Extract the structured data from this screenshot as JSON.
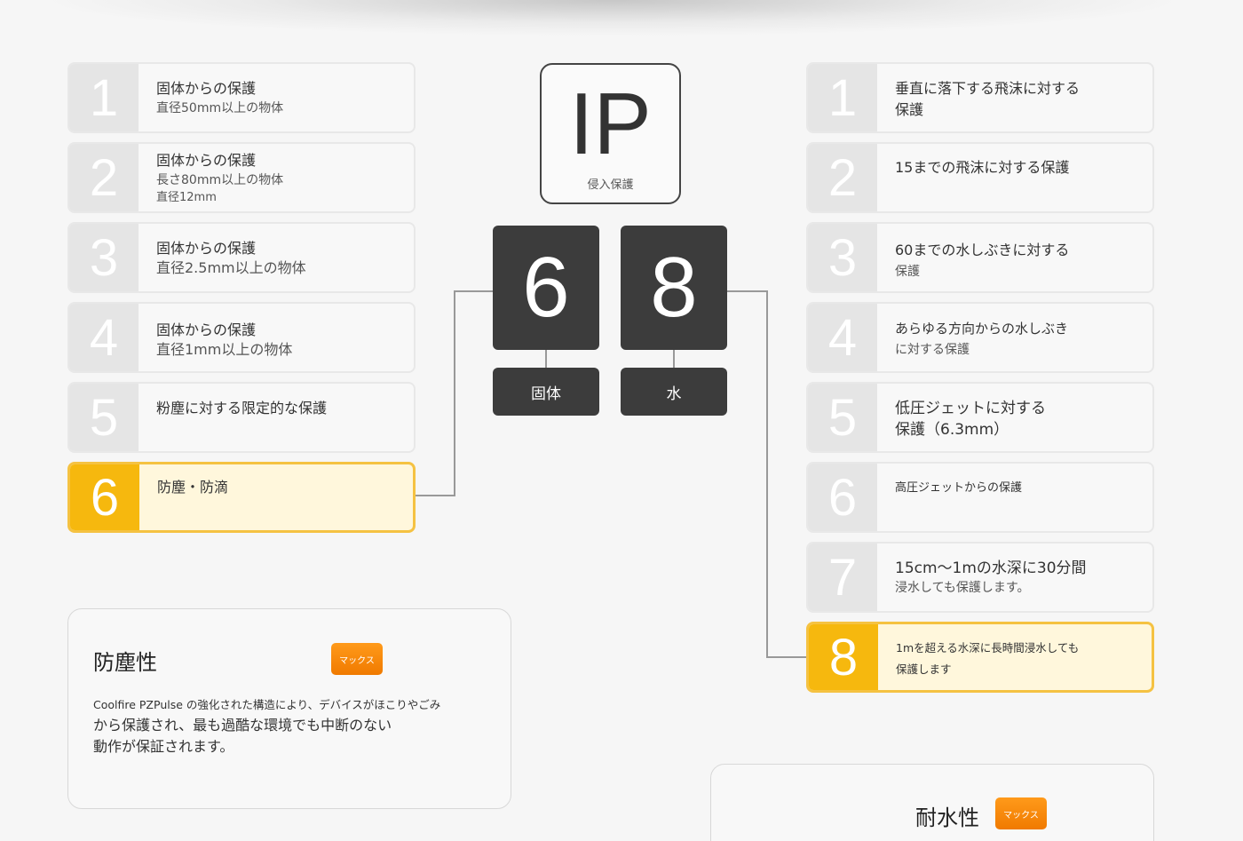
{
  "ip": {
    "letters": "IP",
    "label": "侵入保護"
  },
  "code": {
    "solid_digit": "6",
    "water_digit": "8",
    "solid_label": "固体",
    "water_label": "水"
  },
  "solid_levels": [
    {
      "num": "1",
      "title": "固体からの保護",
      "sub": "直径50mm以上の物体"
    },
    {
      "num": "2",
      "title": "固体からの保護",
      "sub": "長さ80mm以上の物体",
      "sub2": "直径12mm"
    },
    {
      "num": "3",
      "title": "固体からの保護",
      "sub": "直径2.5mm以上の物体"
    },
    {
      "num": "4",
      "title": "固体からの保護",
      "sub": "直径1mm以上の物体"
    },
    {
      "num": "5",
      "title": "粉塵に対する限定的な保護"
    },
    {
      "num": "6",
      "title": "防塵・防滴"
    }
  ],
  "water_levels": [
    {
      "num": "1",
      "title": "垂直に落下する飛沫に対する",
      "sub": "保護"
    },
    {
      "num": "2",
      "title": "15までの飛沫に対する保護"
    },
    {
      "num": "3",
      "title": "60までの水しぶきに対する",
      "sub": "保護"
    },
    {
      "num": "4",
      "title": "あらゆる方向からの水しぶき",
      "sub": "に対する保護"
    },
    {
      "num": "5",
      "title": "低圧ジェットに対する",
      "sub": "保護（6.3mm）"
    },
    {
      "num": "6",
      "title": "高圧ジェットからの保護"
    },
    {
      "num": "7",
      "title": "15cm〜1mの水深に30分間",
      "sub": "浸水しても保護します。"
    },
    {
      "num": "8",
      "title": "1mを超える水深に長時間浸水しても",
      "sub": "保護します"
    }
  ],
  "dust_card": {
    "title": "防塵性",
    "badge": "マックス",
    "line1": "Coolfire PZPulse の強化された構造により、デバイスがほこりやごみ",
    "line2": "から保護され、最も過酷な環境でも中断のない",
    "line3": "動作が保証されます。"
  },
  "water_card": {
    "title": "耐水性",
    "badge": "マックス"
  },
  "colors": {
    "accent": "#f6b80e",
    "dark": "#3c3c3c",
    "badge": "#f07a00"
  }
}
